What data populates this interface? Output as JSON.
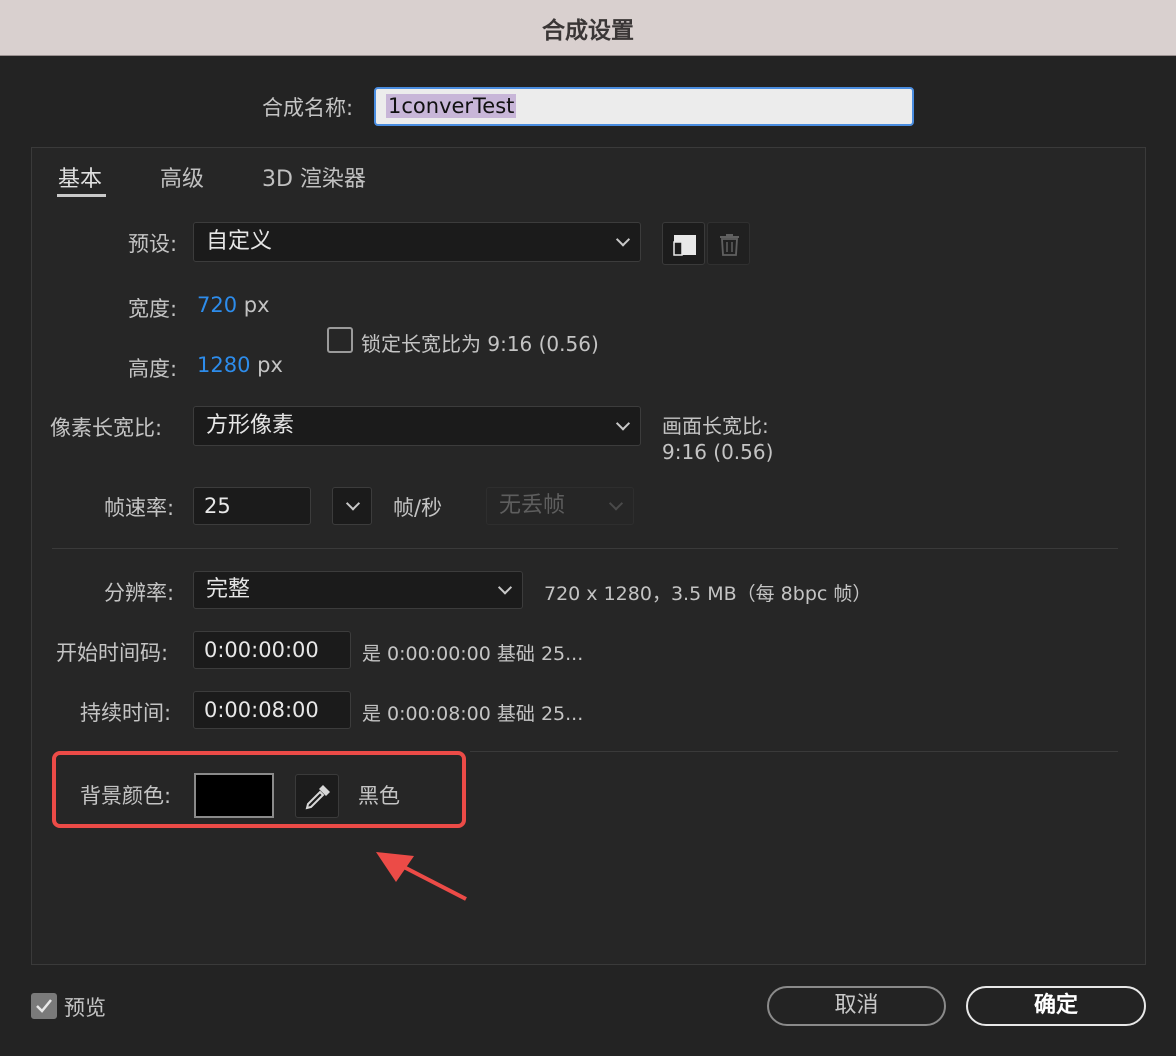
{
  "window": {
    "title": "合成设置"
  },
  "comp_name": {
    "label": "合成名称:",
    "value": "1converTest"
  },
  "tabs": [
    {
      "label": "基本",
      "active": true
    },
    {
      "label": "高级",
      "active": false
    },
    {
      "label": "3D 渲染器",
      "active": false
    }
  ],
  "preset": {
    "label": "预设:",
    "value": "自定义"
  },
  "width": {
    "label": "宽度:",
    "value": "720",
    "unit": "px"
  },
  "height": {
    "label": "高度:",
    "value": "1280",
    "unit": "px"
  },
  "lock_aspect": {
    "label": "锁定长宽比为 9:16 (0.56)",
    "checked": false
  },
  "pixel_aspect": {
    "label": "像素长宽比:",
    "value": "方形像素"
  },
  "frame_aspect": {
    "label": "画面长宽比:",
    "value": "9:16 (0.56)"
  },
  "frame_rate": {
    "label": "帧速率:",
    "value": "25",
    "unit": "帧/秒",
    "drop_frame": "无丢帧"
  },
  "resolution": {
    "label": "分辨率:",
    "value": "完整",
    "info": "720 x 1280，3.5 MB（每 8bpc 帧）"
  },
  "start_timecode": {
    "label": "开始时间码:",
    "value": "0:00:00:00",
    "info": "是 0:00:00:00  基础 25..."
  },
  "duration": {
    "label": "持续时间:",
    "value": "0:00:08:00",
    "info": "是 0:00:08:00  基础 25..."
  },
  "background_color": {
    "label": "背景颜色:",
    "name": "黑色",
    "color": "#000000"
  },
  "preview": {
    "label": "预览",
    "checked": true
  },
  "buttons": {
    "cancel": "取消",
    "ok": "确定"
  },
  "colors": {
    "accent_blue": "#2d8ceb",
    "highlight_red": "#ec4b47",
    "title_bar": "#d9d0cf"
  }
}
